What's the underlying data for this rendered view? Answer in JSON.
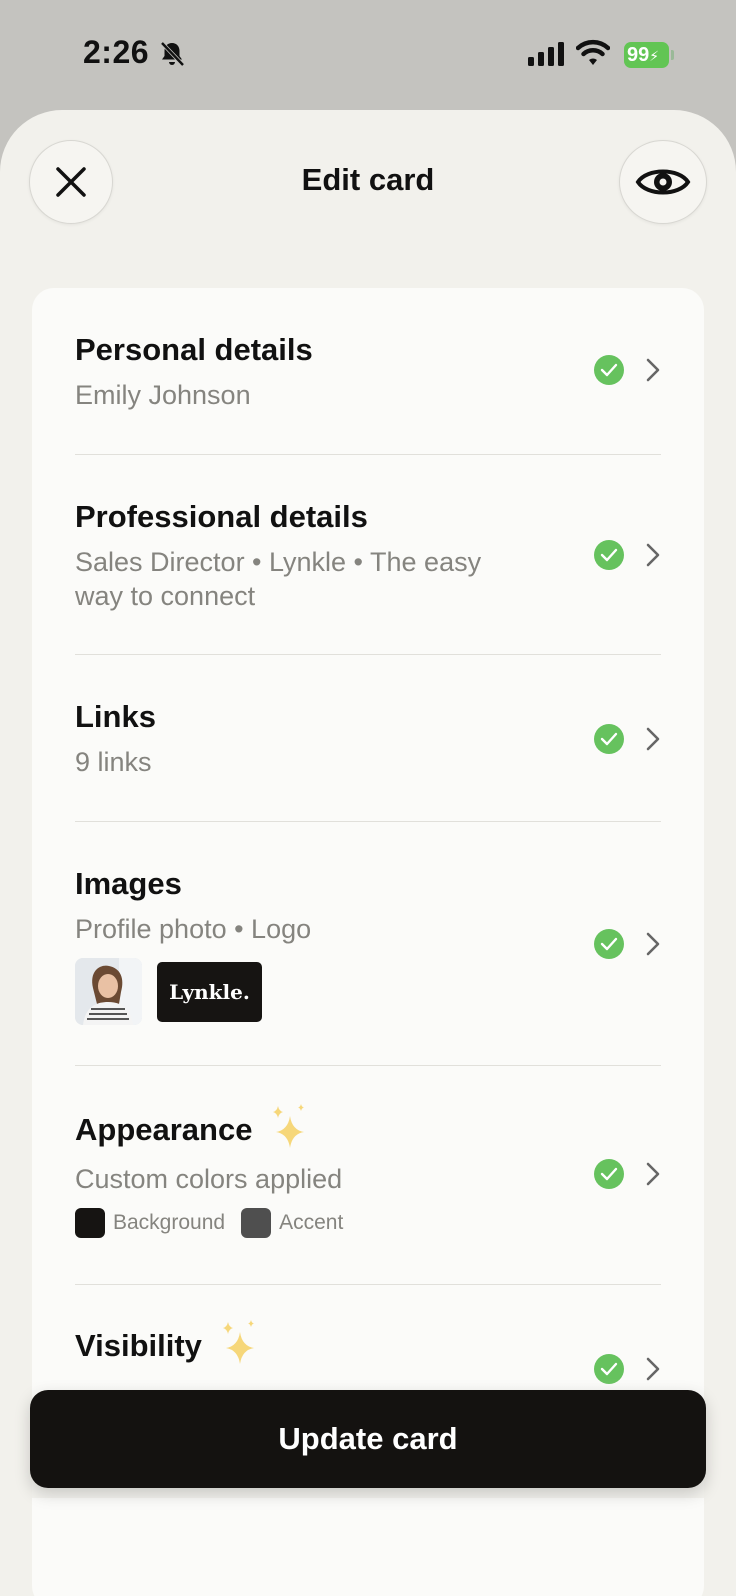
{
  "status_bar": {
    "time": "2:26",
    "battery": "99"
  },
  "header": {
    "title": "Edit card"
  },
  "sections": [
    {
      "title": "Personal details",
      "subtitle": "Emily Johnson"
    },
    {
      "title": "Professional details",
      "subtitle": "Sales Director • Lynkle • The easy way to connect"
    },
    {
      "title": "Links",
      "subtitle": "9 links"
    },
    {
      "title": "Images",
      "subtitle": "Profile photo • Logo",
      "logo_text": "Lynkle."
    },
    {
      "title": "Appearance",
      "subtitle": "Custom colors applied",
      "swatches": [
        {
          "label": "Background",
          "color": "#161412"
        },
        {
          "label": "Accent",
          "color": "#4f4f4f"
        }
      ]
    },
    {
      "title": "Visibility"
    }
  ],
  "footer": {
    "button_label": "Update card"
  },
  "colors": {
    "accent_check": "#66c25e",
    "sheet": "#f2f1ec",
    "button": "#141210"
  }
}
